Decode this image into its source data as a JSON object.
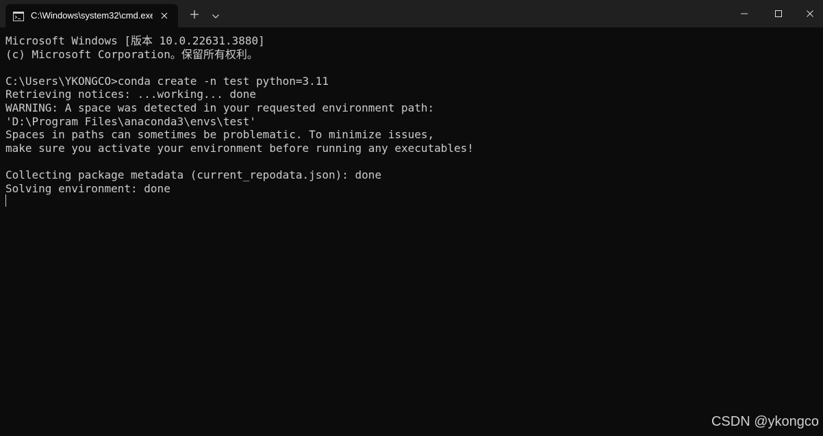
{
  "window": {
    "tab_title": "C:\\Windows\\system32\\cmd.exe",
    "icons": {
      "tab": "terminal-app-icon",
      "tab_close": "close-icon",
      "new_tab": "plus-icon",
      "dropdown": "chevron-down-icon",
      "minimize": "minimize-icon",
      "maximize": "maximize-icon",
      "close": "close-icon"
    }
  },
  "terminal": {
    "lines": [
      "Microsoft Windows [版本 10.0.22631.3880]",
      "(c) Microsoft Corporation。保留所有权利。",
      "",
      "C:\\Users\\YKONGCO>conda create -n test python=3.11",
      "Retrieving notices: ...working... done",
      "WARNING: A space was detected in your requested environment path:",
      "'D:\\Program Files\\anaconda3\\envs\\test'",
      "Spaces in paths can sometimes be problematic. To minimize issues,",
      "make sure you activate your environment before running any executables!",
      "",
      "Collecting package metadata (current_repodata.json): done",
      "Solving environment: done"
    ]
  },
  "watermark": "CSDN @ykongco",
  "colors": {
    "background": "#0c0c0c",
    "titlebar": "#202020",
    "text": "#cccccc"
  }
}
